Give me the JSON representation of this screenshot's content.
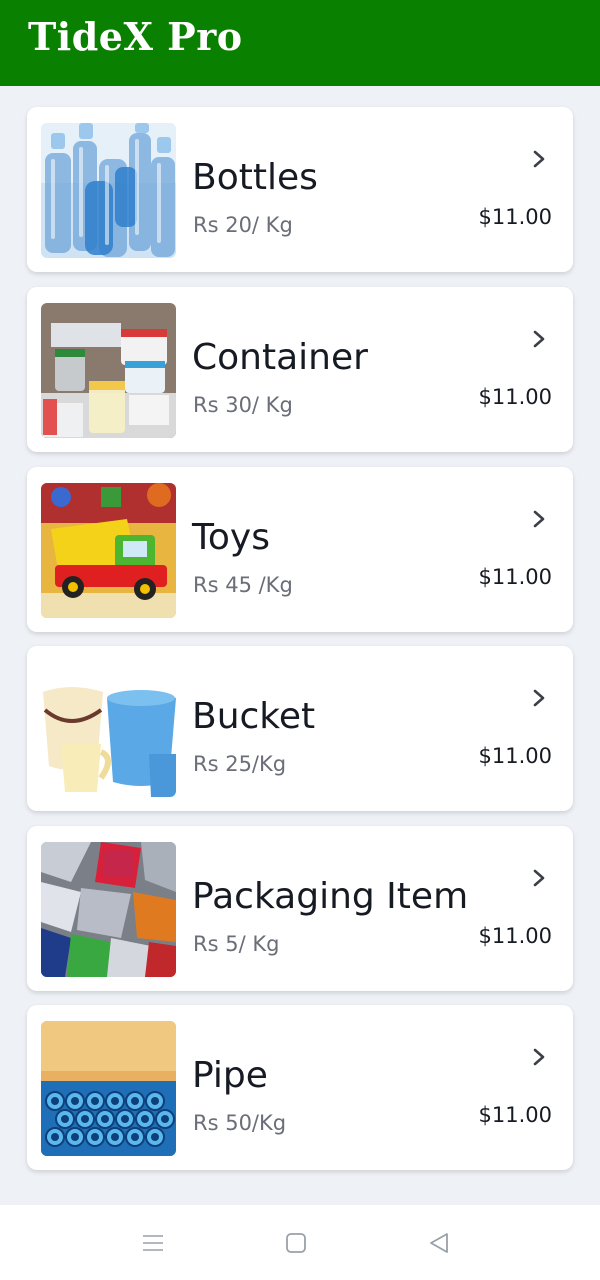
{
  "app": {
    "title": "TideX Pro",
    "header_color": "#0a8000"
  },
  "products": [
    {
      "name": "Bottles",
      "rate": "Rs 20/ Kg",
      "price": "$11.00",
      "image": "plastic-bottles"
    },
    {
      "name": "Container",
      "rate": "Rs 30/ Kg",
      "price": "$11.00",
      "image": "plastic-containers"
    },
    {
      "name": "Toys",
      "rate": "Rs 45 /Kg",
      "price": "$11.00",
      "image": "toy-truck"
    },
    {
      "name": "Bucket",
      "rate": "Rs 25/Kg",
      "price": "$11.00",
      "image": "buckets-and-mugs"
    },
    {
      "name": "Packaging Item",
      "rate": "Rs 5/ Kg",
      "price": "$11.00",
      "image": "packaging-waste"
    },
    {
      "name": "Pipe",
      "rate": "Rs 50/Kg",
      "price": "$11.00",
      "image": "blue-pipes"
    }
  ],
  "navigation": {
    "buttons": [
      "menu-icon",
      "home-square-icon",
      "back-triangle-icon"
    ]
  }
}
